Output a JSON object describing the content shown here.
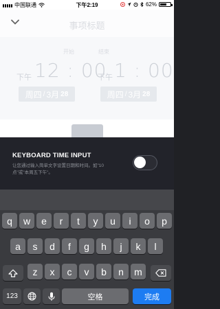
{
  "status_bar": {
    "carrier": "中国联通",
    "time": "下午2:19",
    "battery": "62%",
    "battery_level": 0.62
  },
  "header": {
    "title": "事项标题"
  },
  "schedule": {
    "start": {
      "label": "开始",
      "ampm": "下午",
      "time": "12 : 00",
      "weekday": "周四",
      "month": "3月",
      "day": "28"
    },
    "end": {
      "label": "结束",
      "ampm": "下午",
      "time": "1 : 00",
      "weekday": "周四",
      "month": "3月",
      "day": "28"
    }
  },
  "panel": {
    "title": "KEYBOARD TIME INPUT",
    "description": "让您通过输入简单文字设置日期和时间。如\"10点\"或\"本周五下午\"。",
    "toggle_on": false
  },
  "keyboard": {
    "row1": [
      "q",
      "w",
      "e",
      "r",
      "t",
      "y",
      "u",
      "i",
      "o",
      "p"
    ],
    "row2": [
      "a",
      "s",
      "d",
      "f",
      "g",
      "h",
      "j",
      "k",
      "l"
    ],
    "row3": [
      "z",
      "x",
      "c",
      "v",
      "b",
      "n",
      "m"
    ],
    "numbers_key": "123",
    "space_key": "空格",
    "done_key": "完成"
  }
}
